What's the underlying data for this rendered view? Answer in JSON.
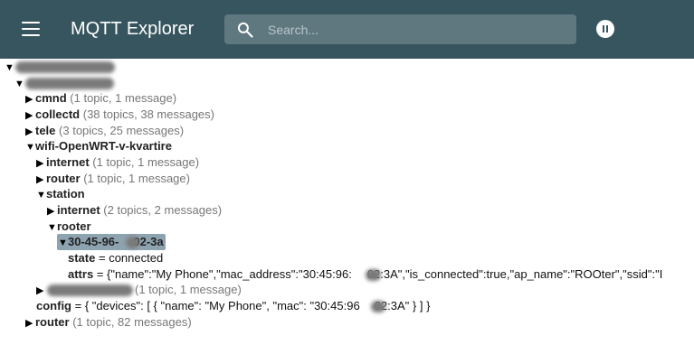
{
  "app": {
    "title": "MQTT Explorer"
  },
  "search": {
    "placeholder": "Search..."
  },
  "icons": {
    "menu": "hamburger-icon",
    "search": "search-icon",
    "pause": "pause-icon"
  },
  "colors": {
    "topbar": "#37555f",
    "search_bg": "#5f7880",
    "selected_row": "#8ea3b0"
  },
  "tree": {
    "cmnd": {
      "name": "cmnd",
      "meta": "(1 topic, 1 message)"
    },
    "collectd": {
      "name": "collectd",
      "meta": "(38 topics, 38 messages)"
    },
    "tele": {
      "name": "tele",
      "meta": "(3 topics, 25 messages)"
    },
    "wifi": {
      "name": "wifi-OpenWRT-v-kvartire"
    },
    "wifi_internet": {
      "name": "internet",
      "meta": "(1 topic, 1 message)"
    },
    "wifi_router": {
      "name": "router",
      "meta": "(1 topic, 1 message)"
    },
    "station": {
      "name": "station"
    },
    "station_internet": {
      "name": "internet",
      "meta": "(2 topics, 2 messages)"
    },
    "rooter": {
      "name": "rooter"
    },
    "device": {
      "name": "30-45-96-",
      "name_tail": "02-3a"
    },
    "state": {
      "key": "state",
      "value": "= connected"
    },
    "attrs": {
      "key": "attrs",
      "value": "= {\"name\":\"My Phone\",\"mac_address\":\"30:45:96:",
      "value_tail": "02:3A\",\"is_connected\":true,\"ap_name\":\"ROOter\",\"ssid\":\"I"
    },
    "redacted_node": {
      "meta": "(1 topic, 1 message)"
    },
    "config": {
      "key": "config",
      "value": "= { \"devices\": [ { \"name\": \"My Phone\", \"mac\": \"30:45:96",
      "value_tail": "02:3A\" } ] }"
    },
    "root_router": {
      "name": "router",
      "meta": "(1 topic, 82 messages)"
    }
  }
}
